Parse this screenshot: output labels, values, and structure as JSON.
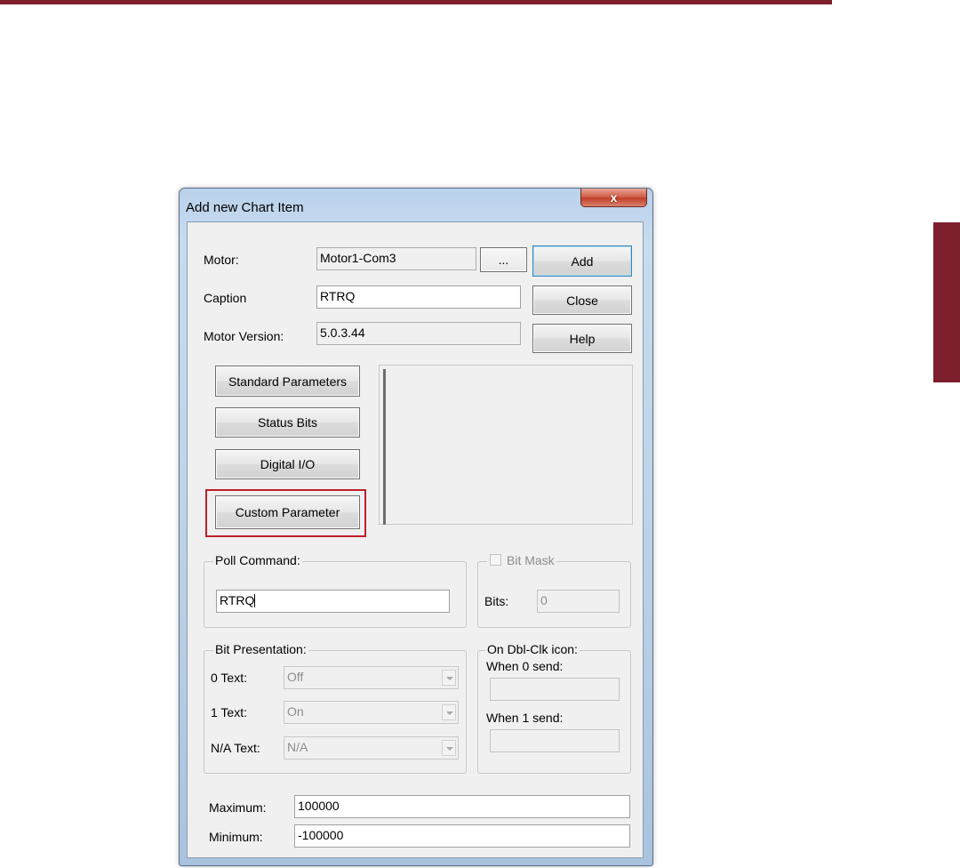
{
  "window": {
    "title": "Add new Chart Item",
    "close_glyph": "x"
  },
  "motor": {
    "label": "Motor:",
    "value": "Motor1-Com3",
    "browse_label": "..."
  },
  "caption": {
    "label": "Caption",
    "value": "RTRQ"
  },
  "motor_version": {
    "label": "Motor Version:",
    "value": "5.0.3.44"
  },
  "actions": {
    "add": "Add",
    "close": "Close",
    "help": "Help"
  },
  "parameter_buttons": {
    "standard": "Standard Parameters",
    "status_bits": "Status Bits",
    "digital_io": "Digital I/O",
    "custom": "Custom Parameter"
  },
  "poll_command": {
    "legend": "Poll Command:",
    "value": "RTRQ"
  },
  "bit_mask": {
    "legend": "Bit Mask",
    "bits_label": "Bits:",
    "bits_value": "0",
    "checked": false
  },
  "bit_presentation": {
    "legend": "Bit Presentation:",
    "zero_label": "0 Text:",
    "zero_value": "Off",
    "one_label": "1 Text:",
    "one_value": "On",
    "na_label": "N/A Text:",
    "na_value": "N/A"
  },
  "dblclk": {
    "legend": "On Dbl-Clk icon:",
    "when0_label": "When 0 send:",
    "when0_value": "",
    "when1_label": "When 1 send:",
    "when1_value": ""
  },
  "range": {
    "max_label": "Maximum:",
    "max_value": "100000",
    "min_label": "Minimum:",
    "min_value": "-100000"
  },
  "colors": {
    "accent": "#7d1f2d",
    "highlight": "#c0202a"
  }
}
